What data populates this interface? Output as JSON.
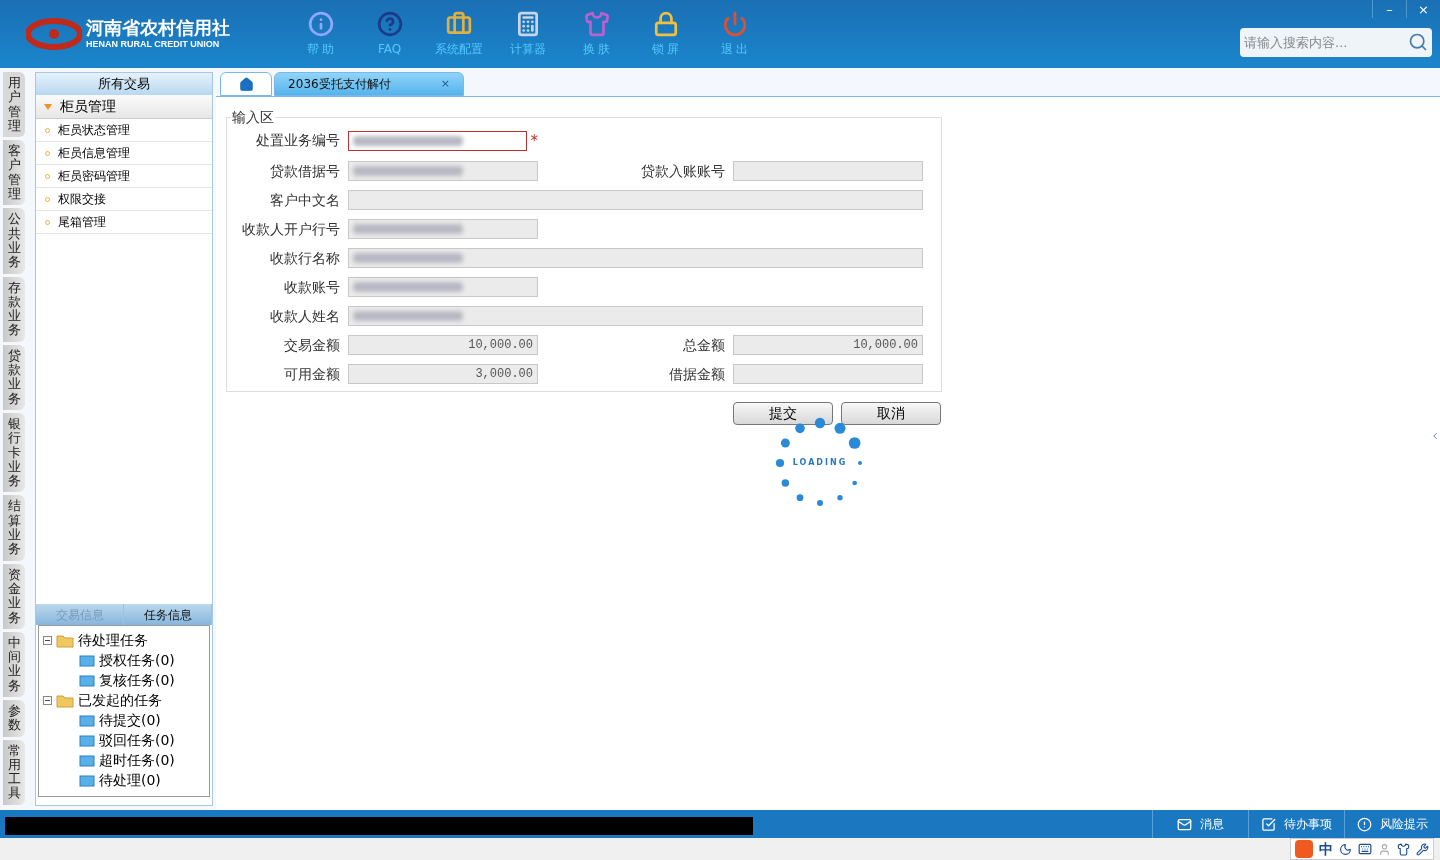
{
  "header": {
    "logo_cn": "河南省农村信用社",
    "logo_en": "HENAN RURAL CREDIT UNION",
    "tools": [
      {
        "kind": "info",
        "label": "帮 助"
      },
      {
        "kind": "faq",
        "label": "FAQ"
      },
      {
        "kind": "toolbox",
        "label": "系统配置"
      },
      {
        "kind": "calculator",
        "label": "计算器"
      },
      {
        "kind": "shirt",
        "label": "换 肤"
      },
      {
        "kind": "lock",
        "label": "锁 屏"
      },
      {
        "kind": "power",
        "label": "退 出"
      }
    ],
    "window_controls": [
      "–",
      "×"
    ],
    "search": {
      "placeholder": "请输入搜索内容..."
    }
  },
  "side_tabs": [
    {
      "label": "用户管理",
      "selected": true
    },
    {
      "label": "客户管理",
      "selected": false
    },
    {
      "label": "公共业务",
      "selected": false
    },
    {
      "label": "存款业务",
      "selected": false
    },
    {
      "label": "贷款业务",
      "selected": false
    },
    {
      "label": "银行卡业务",
      "selected": false
    },
    {
      "label": "结算业务",
      "selected": false
    },
    {
      "label": "资金业务",
      "selected": false
    },
    {
      "label": "中间业务",
      "selected": false
    },
    {
      "label": "参数",
      "selected": false
    },
    {
      "label": "常用工具",
      "selected": false
    }
  ],
  "sidebar": {
    "title": "所有交易",
    "group": {
      "label": "柜员管理",
      "expanded": true
    },
    "items": [
      "柜员状态管理",
      "柜员信息管理",
      "柜员密码管理",
      "权限交接",
      "尾箱管理"
    ],
    "info_tabs": [
      {
        "label": "交易信息",
        "selected": false
      },
      {
        "label": "任务信息",
        "selected": true
      }
    ],
    "tree": [
      {
        "label": "待处理任务",
        "expanded": true,
        "children": [
          {
            "label": "授权任务(0)"
          },
          {
            "label": "复核任务(0)"
          }
        ]
      },
      {
        "label": "已发起的任务",
        "expanded": true,
        "children": [
          {
            "label": "待提交(0)"
          },
          {
            "label": "驳回任务(0)"
          },
          {
            "label": "超时任务(0)"
          },
          {
            "label": "待处理(0)"
          }
        ]
      }
    ]
  },
  "tabs": [
    {
      "kind": "home",
      "selected": false
    },
    {
      "kind": "text",
      "label": "2036受托支付解付",
      "close": "×",
      "selected": true
    }
  ],
  "form": {
    "legend": "输入区",
    "required_mark": "*",
    "rows": [
      [
        {
          "label": "处置业务编号",
          "wide": false,
          "redacted": true,
          "required": true
        }
      ],
      [
        {
          "label": "贷款借据号",
          "wide": false,
          "redacted": true,
          "required": false
        },
        {
          "label": "贷款入账账号",
          "wide": false,
          "redacted": false,
          "required": false
        }
      ],
      [
        {
          "label": "客户中文名",
          "wide": true,
          "redacted": false,
          "required": false
        }
      ],
      [
        {
          "label": "收款人开户行号",
          "wide": false,
          "redacted": true,
          "required": false
        }
      ],
      [
        {
          "label": "收款行名称",
          "wide": true,
          "redacted": true,
          "required": false
        }
      ],
      [
        {
          "label": "收款账号",
          "wide": false,
          "redacted": true,
          "required": false
        }
      ],
      [
        {
          "label": "收款人姓名",
          "wide": true,
          "redacted": true,
          "required": false
        }
      ],
      [
        {
          "label": "交易金额",
          "wide": false,
          "value": "10,000.00",
          "redacted": false,
          "required": false
        },
        {
          "label": "总金额",
          "wide": false,
          "value": "10,000.00",
          "redacted": false,
          "required": false
        }
      ],
      [
        {
          "label": "可用金额",
          "wide": false,
          "value": "3,000.00",
          "redacted": false,
          "required": false
        },
        {
          "label": "借据金额",
          "wide": false,
          "redacted": false,
          "required": false
        }
      ]
    ],
    "buttons": [
      "提交",
      "取消"
    ]
  },
  "loading": {
    "label": "LOADING"
  },
  "status_bar": {
    "items": [
      {
        "kind": "message",
        "label": "消息"
      },
      {
        "kind": "todo",
        "label": "待办事项"
      },
      {
        "kind": "risk",
        "label": "风险提示"
      }
    ]
  },
  "ime": {
    "label": "中"
  }
}
